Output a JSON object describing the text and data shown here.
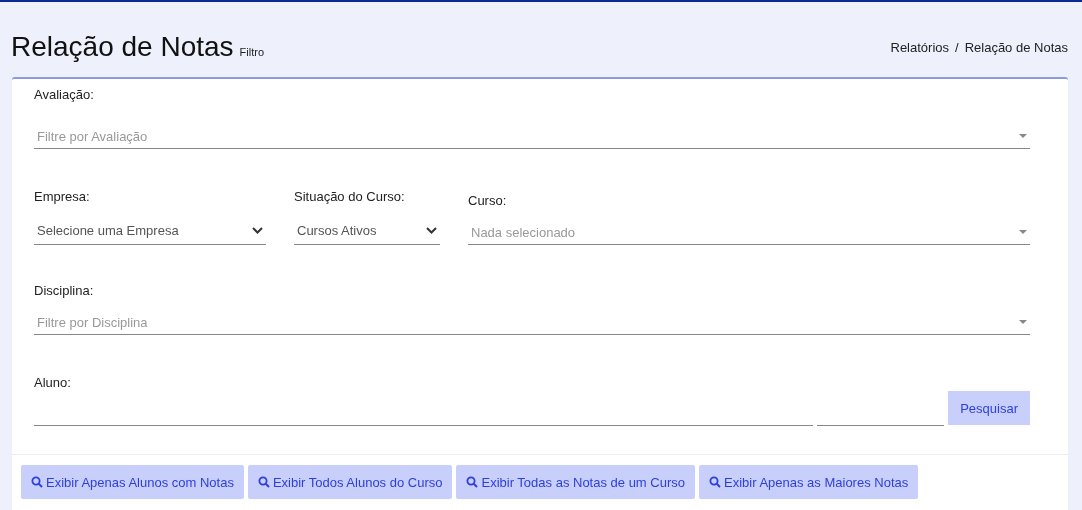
{
  "header": {
    "title": "Relação de Notas",
    "subtitle": "Filtro",
    "breadcrumb": [
      "Relatórios",
      "Relação de Notas"
    ],
    "separator": "/"
  },
  "rows": [
    {
      "fields": [
        {
          "kind": "search-select",
          "label": "Avaliação:",
          "placeholder": "Filtre por Avaliação"
        }
      ]
    },
    {
      "fields": [
        {
          "kind": "select",
          "label": "Empresa:",
          "value": "Selecione uma Empresa"
        },
        {
          "kind": "select",
          "label": "Situação do Curso:",
          "value": "Cursos Ativos"
        },
        {
          "kind": "search-select",
          "label": "Curso:",
          "placeholder": "Nada selecionado"
        }
      ]
    },
    {
      "fields": [
        {
          "kind": "search-select",
          "label": "Disciplina:",
          "placeholder": "Filtre por Disciplina"
        }
      ]
    },
    {
      "fields": [
        {
          "kind": "text",
          "label": "Aluno:"
        },
        {
          "kind": "text"
        },
        {
          "kind": "button",
          "label": "Pesquisar"
        }
      ]
    }
  ],
  "actions": [
    "Exibir Apenas Alunos com Notas",
    "Exibir Todos Alunos do Curso",
    "Exibir Todas as Notas de um Curso",
    "Exibir Apenas as Maiores Notas"
  ]
}
